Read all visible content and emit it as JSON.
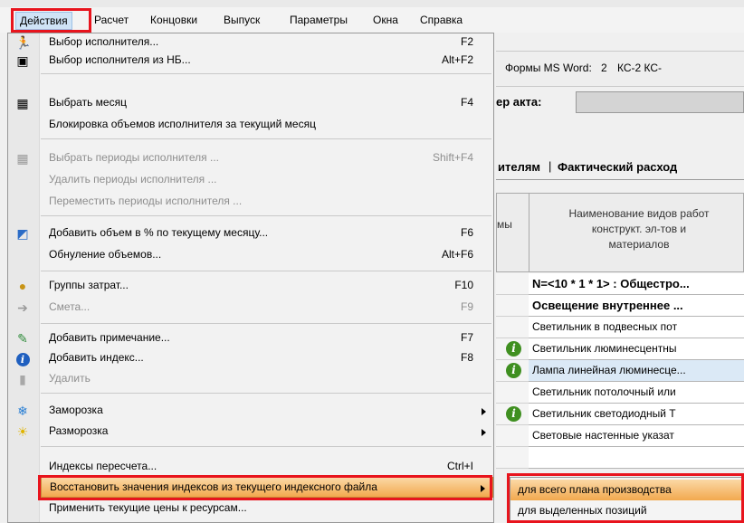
{
  "menubar": [
    "Действия",
    "Расчет",
    "Концовки",
    "Выпуск",
    "Параметры",
    "Окна",
    "Справка"
  ],
  "app": {
    "forms_label": "Формы MS Word:",
    "forms_num": "2",
    "forms_ks": "КС-2  КС-",
    "act_label": "ер акта:",
    "tab1": "ителям",
    "tab2": "Фактический расход",
    "left_head": "мы",
    "grid_head": [
      "Наименование видов работ",
      "конструкт. эл-тов и",
      "материалов"
    ],
    "rows": [
      "N=<10 * 1 * 1> : Общестро...",
      "Освещение внутреннее ...",
      "Светильник в подвесных пот",
      "Светильник люминесцентны",
      "Лампа линейная люминесце...",
      "Светильник потолочный или",
      "Светильник светодиодный Т",
      "Световые настенные указат"
    ]
  },
  "menu": {
    "items": [
      {
        "label": "Выбор исполнителя...",
        "shortcut": "F2",
        "icon": "runner-icon",
        "disabled": false
      },
      {
        "label": "Выбор исполнителя из НБ...",
        "shortcut": "Alt+F2",
        "icon": "runner-db-icon",
        "disabled": false
      },
      {
        "label": "Выбрать месяц",
        "shortcut": "F4",
        "icon": "calendar-icon",
        "disabled": false
      },
      {
        "label": "Блокировка объемов исполнителя за текущий месяц",
        "shortcut": "",
        "icon": "",
        "disabled": false
      },
      {
        "label": "Выбрать периоды исполнителя ...",
        "shortcut": "Shift+F4",
        "icon": "grid-icon",
        "disabled": true
      },
      {
        "label": "Удалить периоды исполнителя ...",
        "shortcut": "",
        "icon": "",
        "disabled": true
      },
      {
        "label": "Переместить периоды исполнителя ...",
        "shortcut": "",
        "icon": "",
        "disabled": true
      },
      {
        "label": "Добавить объем в % по текущему месяцу...",
        "shortcut": "F6",
        "icon": "chart-icon",
        "disabled": false
      },
      {
        "label": "Обнуление объемов...",
        "shortcut": "Alt+F6",
        "icon": "",
        "disabled": false
      },
      {
        "label": "Группы затрат...",
        "shortcut": "F10",
        "icon": "coins-icon",
        "disabled": false
      },
      {
        "label": "Смета...",
        "shortcut": "F9",
        "icon": "arrow-right-icon",
        "disabled": true
      },
      {
        "label": "Добавить примечание...",
        "shortcut": "F7",
        "icon": "note-icon",
        "disabled": false
      },
      {
        "label": "Добавить индекс...",
        "shortcut": "F8",
        "icon": "info-icon",
        "disabled": false
      },
      {
        "label": "Удалить",
        "shortcut": "",
        "icon": "trash-icon",
        "disabled": true
      },
      {
        "label": "Заморозка",
        "shortcut": "",
        "icon": "snowflake-icon",
        "disabled": false
      },
      {
        "label": "Разморозка",
        "shortcut": "",
        "icon": "sun-icon",
        "disabled": false
      },
      {
        "label": "Индексы пересчета...",
        "shortcut": "Ctrl+I",
        "icon": "",
        "disabled": false
      },
      {
        "label": "Восстановить значения индексов из текущего индексного файла",
        "shortcut": "",
        "icon": "",
        "disabled": false
      },
      {
        "label": "Применить текущие цены к ресурсам...",
        "shortcut": "",
        "icon": "",
        "disabled": false
      }
    ]
  },
  "submenu": {
    "items": [
      "для всего плана производства",
      "для выделенных позиций"
    ]
  }
}
